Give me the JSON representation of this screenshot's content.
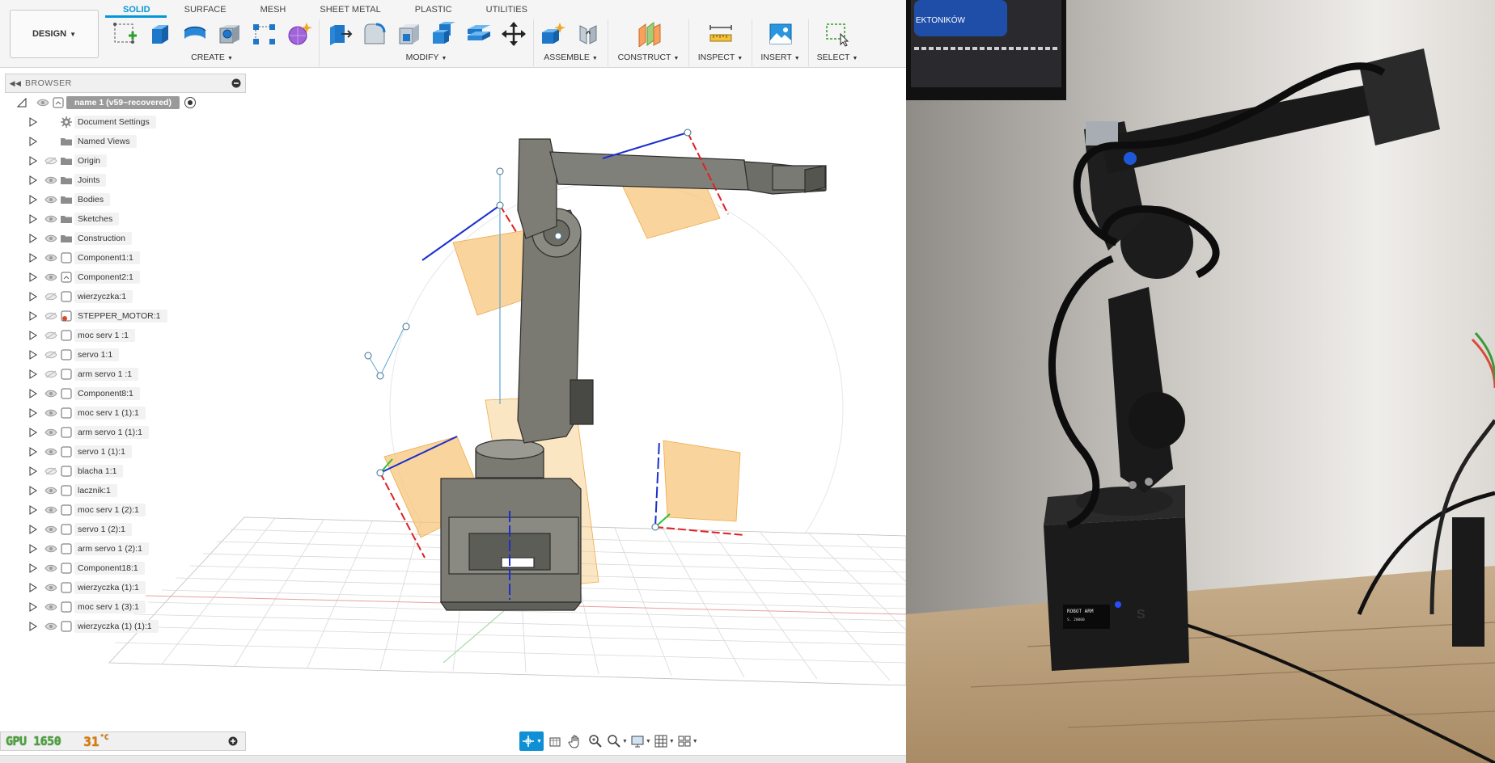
{
  "workspace": {
    "label": "DESIGN"
  },
  "tabs": [
    {
      "label": "SOLID",
      "active": true
    },
    {
      "label": "SURFACE",
      "active": false
    },
    {
      "label": "MESH",
      "active": false
    },
    {
      "label": "SHEET METAL",
      "active": false
    },
    {
      "label": "PLASTIC",
      "active": false
    },
    {
      "label": "UTILITIES",
      "active": false
    }
  ],
  "tool_groups": [
    {
      "label": "CREATE",
      "icons": [
        "create-sketch-icon",
        "extrude-icon",
        "revolve-icon",
        "hole-icon",
        "pattern-icon",
        "create-form-icon"
      ]
    },
    {
      "label": "MODIFY",
      "icons": [
        "press-pull-icon",
        "fillet-icon",
        "shell-icon",
        "combine-icon",
        "offset-face-icon",
        "move-copy-icon"
      ]
    },
    {
      "label": "ASSEMBLE",
      "icons": [
        "new-component-icon",
        "joint-icon"
      ]
    },
    {
      "label": "CONSTRUCT",
      "icons": [
        "offset-plane-icon"
      ]
    },
    {
      "label": "INSPECT",
      "icons": [
        "measure-icon"
      ]
    },
    {
      "label": "INSERT",
      "icons": [
        "insert-image-icon"
      ]
    },
    {
      "label": "SELECT",
      "icons": [
        "window-select-icon"
      ]
    }
  ],
  "browser": {
    "title": "BROWSER",
    "root": {
      "label": "name 1 (v59~recovered)"
    },
    "items": [
      {
        "label": "Document Settings",
        "icon": "gear-icon",
        "eye": "none"
      },
      {
        "label": "Named Views",
        "icon": "folder-icon",
        "eye": "none"
      },
      {
        "label": "Origin",
        "icon": "folder-icon",
        "eye": "hidden"
      },
      {
        "label": "Joints",
        "icon": "folder-icon",
        "eye": "visible"
      },
      {
        "label": "Bodies",
        "icon": "folder-icon",
        "eye": "visible"
      },
      {
        "label": "Sketches",
        "icon": "folder-icon",
        "eye": "visible"
      },
      {
        "label": "Construction",
        "icon": "folder-icon",
        "eye": "visible"
      },
      {
        "label": "Component1:1",
        "icon": "component-icon",
        "eye": "visible"
      },
      {
        "label": "Component2:1",
        "icon": "component-link-icon",
        "eye": "visible"
      },
      {
        "label": "wierzyczka:1",
        "icon": "component-icon",
        "eye": "hidden"
      },
      {
        "label": "STEPPER_MOTOR:1",
        "icon": "component-error-icon",
        "eye": "hidden"
      },
      {
        "label": "moc serv 1 :1",
        "icon": "component-icon",
        "eye": "hidden"
      },
      {
        "label": "servo 1:1",
        "icon": "component-icon",
        "eye": "hidden"
      },
      {
        "label": "arm servo 1 :1",
        "icon": "component-icon",
        "eye": "hidden"
      },
      {
        "label": "Component8:1",
        "icon": "component-icon",
        "eye": "visible"
      },
      {
        "label": "moc serv 1  (1):1",
        "icon": "component-icon",
        "eye": "visible"
      },
      {
        "label": "arm servo 1  (1):1",
        "icon": "component-icon",
        "eye": "visible"
      },
      {
        "label": "servo 1 (1):1",
        "icon": "component-icon",
        "eye": "visible"
      },
      {
        "label": "blacha 1:1",
        "icon": "component-icon",
        "eye": "hidden"
      },
      {
        "label": "lacznik:1",
        "icon": "component-icon",
        "eye": "visible"
      },
      {
        "label": "moc serv 1  (2):1",
        "icon": "component-icon",
        "eye": "visible"
      },
      {
        "label": "servo 1 (2):1",
        "icon": "component-icon",
        "eye": "visible"
      },
      {
        "label": "arm servo 1  (2):1",
        "icon": "component-icon",
        "eye": "visible"
      },
      {
        "label": "Component18:1",
        "icon": "component-icon",
        "eye": "visible"
      },
      {
        "label": "wierzyczka (1):1",
        "icon": "component-icon",
        "eye": "visible"
      },
      {
        "label": "moc serv 1  (3):1",
        "icon": "component-icon",
        "eye": "visible"
      },
      {
        "label": "wierzyczka (1) (1):1",
        "icon": "component-icon",
        "eye": "visible"
      }
    ]
  },
  "overlay": {
    "gpu_label": "GPU 1650",
    "gpu_temp": "31",
    "gpu_temp_unit": "°C"
  },
  "nav_bar": {
    "icons": [
      "orbit-constrained-icon",
      "look-at-icon",
      "pan-icon",
      "zoom-icon",
      "fit-icon",
      "display-settings-icon",
      "grid-settings-icon",
      "viewports-icon"
    ]
  },
  "photo": {
    "frame_text": "EKTONIKÓW",
    "oled_title": "ROBOT ARM",
    "oled_subtitle": "S. 20000",
    "logo_text": "S"
  },
  "colors": {
    "accent": "#0696d7",
    "model_gray": "#808080",
    "plane_orange": "#f7c77c"
  }
}
